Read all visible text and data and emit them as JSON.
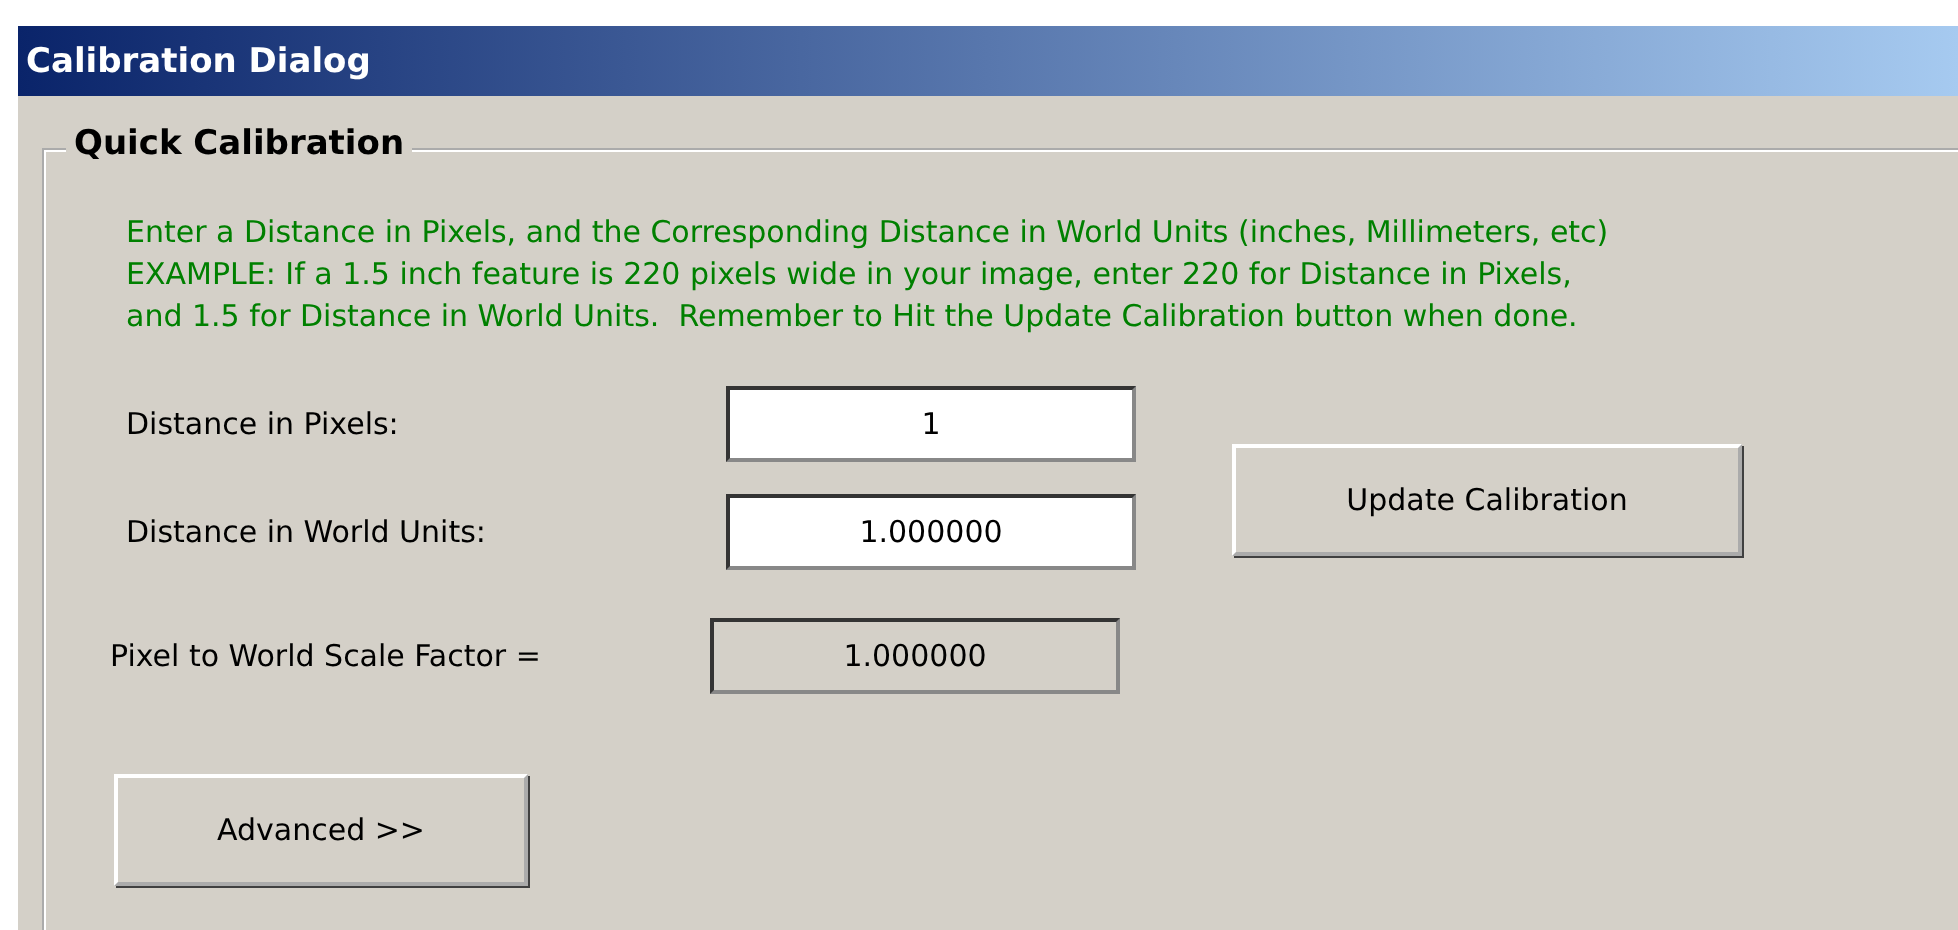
{
  "window": {
    "title": "Calibration Dialog"
  },
  "group": {
    "title": "Quick Calibration",
    "instructions": [
      "Enter a Distance in Pixels, and the Corresponding Distance in World Units (inches, Millimeters, etc)",
      "EXAMPLE: If a 1.5 inch feature is 220 pixels wide in your image, enter 220 for Distance in Pixels,",
      "and 1.5 for Distance in World Units.  Remember to Hit the Update Calibration button when done."
    ],
    "fields": [
      {
        "label": "Distance in Pixels:",
        "value": "1",
        "kind": "input"
      },
      {
        "label": "Distance in World Units:",
        "value": "1.000000",
        "kind": "input"
      },
      {
        "label": "Pixel to World Scale Factor =",
        "value": "1.000000",
        "kind": "readonly"
      }
    ],
    "update_button": "Update Calibration",
    "advanced_button": "Advanced >>"
  }
}
